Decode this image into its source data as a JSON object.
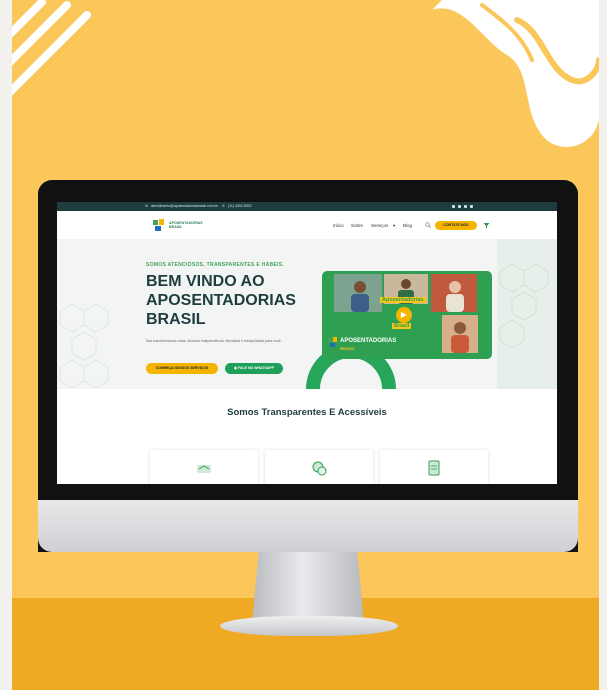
{
  "colors": {
    "background": "#fbc65a",
    "floor": "#f0a923",
    "primary_dark": "#1e3d3f",
    "accent_green": "#1fa05a",
    "accent_yellow": "#f5b400"
  },
  "site": {
    "topbar": {
      "email": "atendimento@aposentadoriasbrasil.com.br",
      "phone": "(11) 4002-8922",
      "social_icons": [
        "facebook-icon",
        "instagram-icon",
        "linkedin-icon",
        "youtube-icon"
      ]
    },
    "brand": {
      "line1": "APOSENTADORIAS",
      "line2": "BRASIL"
    },
    "nav": {
      "items": [
        "Início",
        "Sobre",
        "Serviços",
        "Blog"
      ],
      "cta": "CONTATE-NOS"
    },
    "hero": {
      "tagline": "SOMOS ATENCIOSOS, TRANSPARENTES E HÁBEIS.",
      "title_lines": [
        "BEM VINDO AO",
        "APOSENTADORIAS",
        "BRASIL"
      ],
      "text": "Nós transformamos vidas, levando independência, felicidade e tranquilidade para você.",
      "button_primary": "CONHEÇA NOSSOS SERVIÇOS",
      "button_secondary": "FALE NO WHATSAPP",
      "video": {
        "overlay_lines": [
          "Aposentadorias",
          "Brasil"
        ],
        "brand_label": "APOSENTADORIAS",
        "brand_sub": "BRASIL"
      }
    },
    "section": {
      "title": "Somos Transparentes E Acessíveis",
      "card_icons": [
        "hands-icon",
        "coins-icon",
        "document-icon"
      ]
    }
  }
}
